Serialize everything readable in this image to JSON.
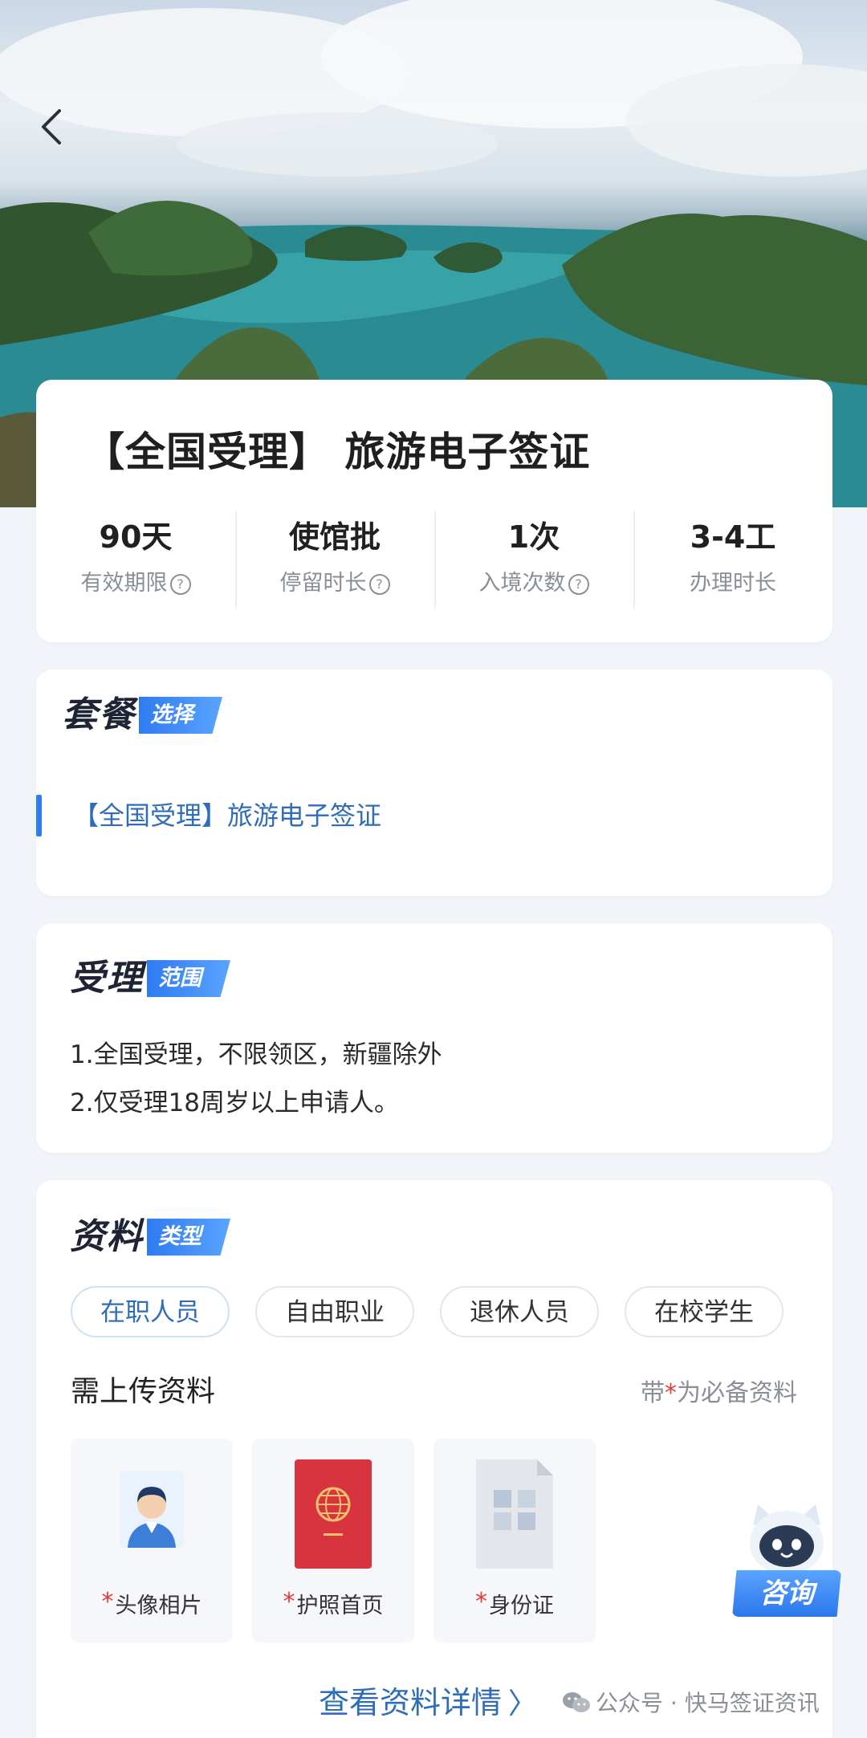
{
  "header": {
    "back_icon": "chevron-left-icon"
  },
  "product": {
    "title": "【全国受理】 旅游电子签证",
    "stats": [
      {
        "value": "90天",
        "label": "有效期限",
        "has_help": true
      },
      {
        "value": "使馆批",
        "label": "停留时长",
        "has_help": true
      },
      {
        "value": "1次",
        "label": "入境次数",
        "has_help": true
      },
      {
        "value": "3-4工",
        "label": "办理时长",
        "has_help": false
      }
    ],
    "help_glyph": "?"
  },
  "package": {
    "title_main": "套餐",
    "title_tag": "选择",
    "selected_item": "【全国受理】旅游电子签证"
  },
  "scope": {
    "title_main": "受理",
    "title_tag": "范围",
    "lines": [
      "1.全国受理，不限领区，新疆除外",
      "2.仅受理18周岁以上申请人。"
    ]
  },
  "documents": {
    "title_main": "资料",
    "title_tag": "类型",
    "tabs": [
      "在职人员",
      "自由职业",
      "退休人员",
      "在校学生"
    ],
    "active_tab": 0,
    "upload_title": "需上传资料",
    "required_note_prefix": "带",
    "required_star": "*",
    "required_note_suffix": "为必备资料",
    "items": [
      {
        "label": "头像相片",
        "icon": "avatar-photo-icon"
      },
      {
        "label": "护照首页",
        "icon": "passport-icon"
      },
      {
        "label": "身份证",
        "icon": "id-card-doc-icon"
      }
    ],
    "detail_link": "查看资料详情",
    "detail_chevron": "〉"
  },
  "consult": {
    "label": "咨询",
    "icon": "robot-mascot-icon"
  },
  "watermark": {
    "text": "公众号 · 快马签证资讯",
    "icon": "wechat-icon"
  },
  "colors": {
    "accent": "#2f7bf2",
    "link": "#2f6db8",
    "required": "#e23b3b"
  }
}
